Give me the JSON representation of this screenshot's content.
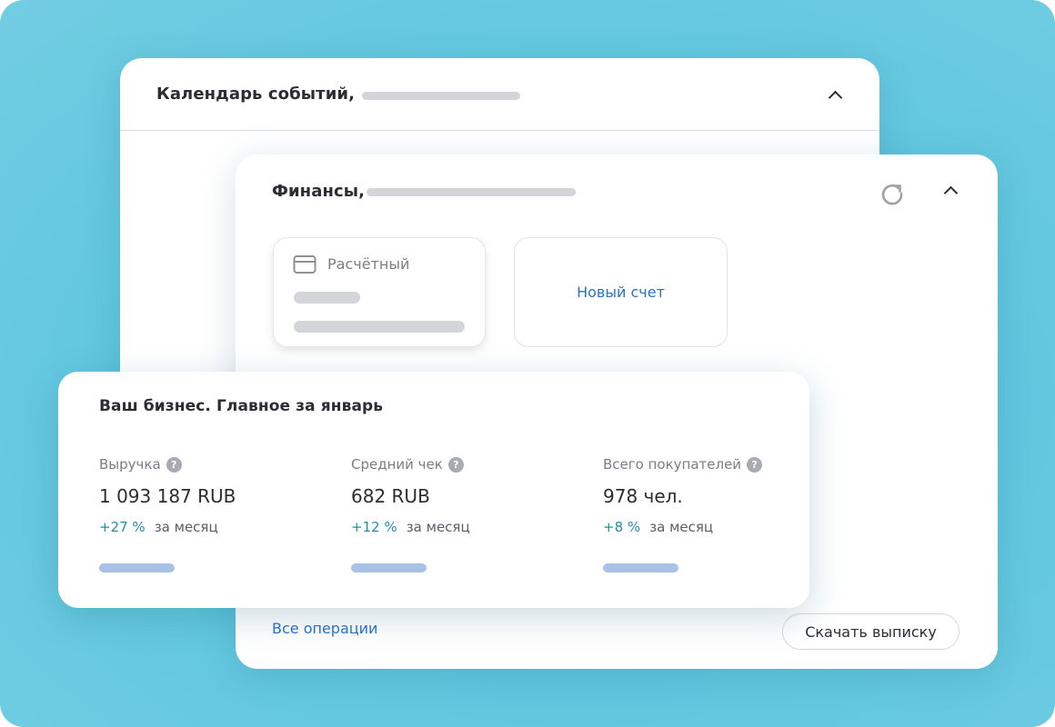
{
  "calendar": {
    "title": "Календарь событий,"
  },
  "finance": {
    "title": "Финансы,",
    "account_label": "Расчётный",
    "new_account": "Новый счет",
    "all_operations": "Все операции",
    "download_statement": "Скачать выписку"
  },
  "business": {
    "title": "Ваш бизнес. Главное за январь",
    "metrics": [
      {
        "label": "Выручка",
        "value": "1 093 187 RUB",
        "delta": "+27 %",
        "period": "за месяц"
      },
      {
        "label": "Средний чек",
        "value": "682 RUB",
        "delta": "+12 %",
        "period": "за месяц"
      },
      {
        "label": "Всего покупателей",
        "value": "978 чел.",
        "delta": "+8 %",
        "period": "за месяц"
      }
    ],
    "help_glyph": "?"
  },
  "icons": [
    "chevron-up-icon",
    "refresh-icon",
    "credit-card-icon",
    "help-icon"
  ],
  "colors": {
    "background": "#5ec6df",
    "link": "#2a73c9",
    "positive": "#1f8fa3",
    "skeleton": "#d3d5d8",
    "bar": "#a9c1e6"
  }
}
